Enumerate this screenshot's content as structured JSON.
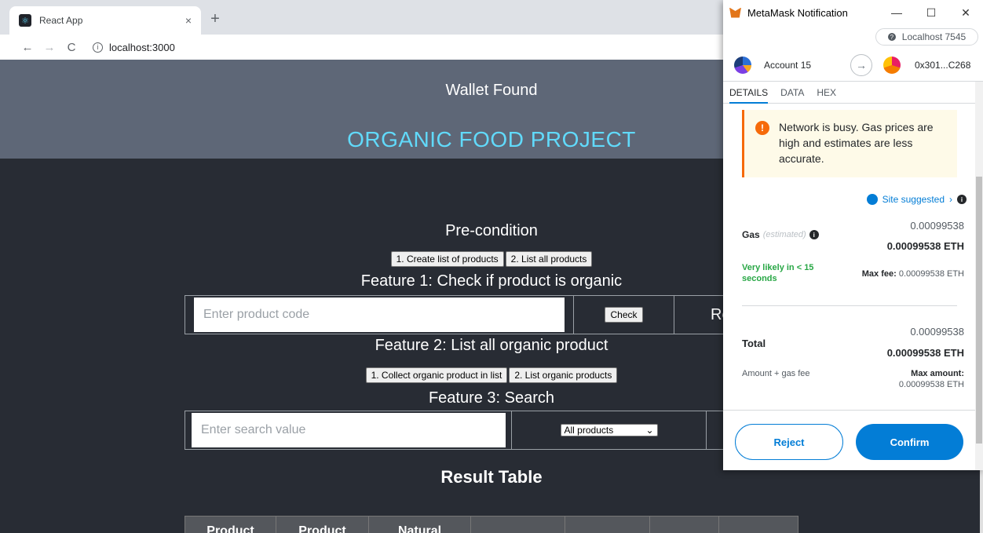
{
  "browser": {
    "tab_title": "React App",
    "tab_close": "×",
    "new_tab": "+",
    "back": "←",
    "forward": "→",
    "reload": "C",
    "url": "localhost:3000",
    "info_icon": "i"
  },
  "header": {
    "wallet_status": "Wallet Found",
    "project_title": "ORGANIC FOOD PROJECT"
  },
  "precondition": {
    "title": "Pre-condition",
    "buttons": [
      "1. Create list of products",
      "2. List all products"
    ]
  },
  "feature1": {
    "title": "Feature 1: Check if product is organic",
    "input_placeholder": "Enter product code",
    "check_label": "Check",
    "result_label": "Re"
  },
  "feature2": {
    "title": "Feature 2: List all organic product",
    "buttons": [
      "1. Collect organic product in list",
      "2. List organic products"
    ]
  },
  "feature3": {
    "title": "Feature 3: Search",
    "input_placeholder": "Enter search value",
    "select_value": "All products"
  },
  "result": {
    "title": "Result Table",
    "columns": [
      "Product",
      "Product",
      "Natural",
      "",
      "",
      "",
      ""
    ]
  },
  "metamask": {
    "window_title": "MetaMask Notification",
    "minimize": "—",
    "maximize": "☐",
    "close": "✕",
    "network": "Localhost 7545",
    "account_name": "Account 15",
    "to_address": "0x301...C268",
    "tabs": [
      "DETAILS",
      "DATA",
      "HEX"
    ],
    "warning": "Network is busy. Gas prices are high and estimates are less accurate.",
    "site_suggested": "Site suggested",
    "gas_label": "Gas",
    "gas_estimated": "(estimated)",
    "gas_fiat": "0.00099538",
    "gas_eth": "0.00099538 ETH",
    "likely": "Very likely in < 15 seconds",
    "max_fee_label": "Max fee:",
    "max_fee_value": "0.00099538 ETH",
    "total_label": "Total",
    "total_fiat": "0.00099538",
    "total_eth": "0.00099538 ETH",
    "amount_gas": "Amount + gas fee",
    "max_amount_label": "Max amount:",
    "max_amount_value": "0.00099538 ETH",
    "reject": "Reject",
    "confirm": "Confirm",
    "colors": {
      "primary": "#037dd6",
      "warning": "#f66a0a",
      "success": "#28a745"
    }
  }
}
